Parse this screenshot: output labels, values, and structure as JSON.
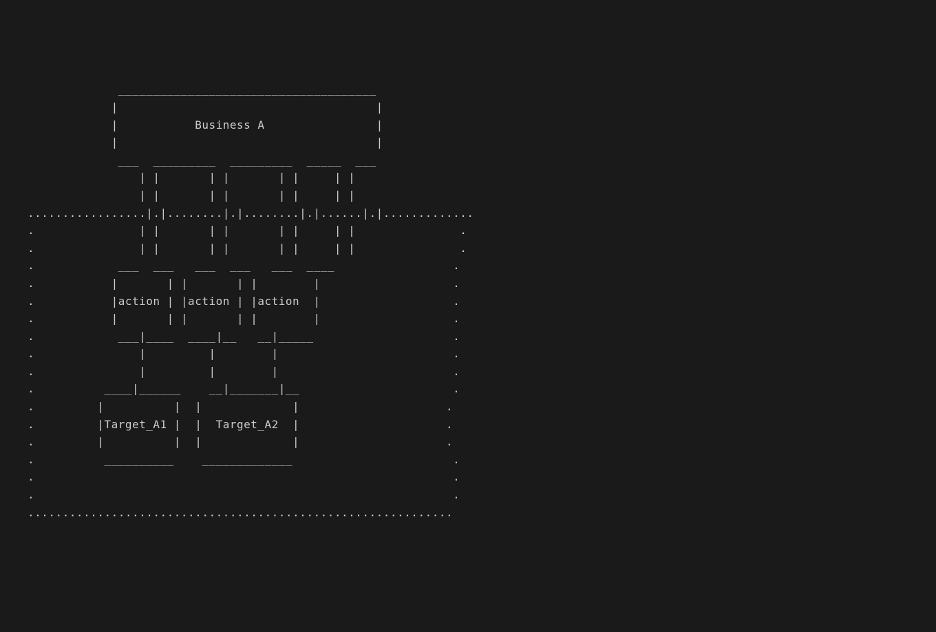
{
  "diagram": {
    "title": "Business A",
    "actions": [
      "action",
      "action",
      "action"
    ],
    "targets": [
      "Target_A1",
      "Target_A2"
    ]
  },
  "ascii_lines": [
    "             _____________________________________",
    "            |                                     |",
    "            |           Business A                |",
    "            |                                     |",
    "             ___  _________  _________  _____  ___",
    "                | |       | |       | |     | |",
    "                | |       | |       | |     | |",
    ".................|.|........|.|........|.|......|.|.............",
    ".               | |       | |       | |     | |               .",
    ".               | |       | |       | |     | |               .",
    ".            ___  ___   ___  ___   ___  ____                 .",
    ".           |       | |       | |        |                   .",
    ".           |action | |action | |action  |                   .",
    ".           |       | |       | |        |                   .",
    ".            ___|____  ____|__   __|_____                    .",
    ".               |         |        |                         .",
    ".               |         |        |                         .",
    ".          ____|______    __|_______|__                      .",
    ".         |          |  |             |                     .",
    ".         |Target_A1 |  |  Target_A2  |                     .",
    ".         |          |  |             |                     .",
    ".          __________    _____________                       .",
    ".                                                            .",
    ".                                                            .",
    "............................................................."
  ]
}
